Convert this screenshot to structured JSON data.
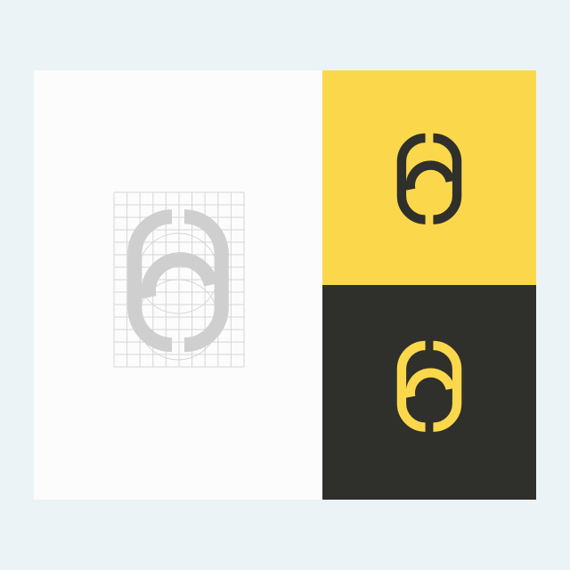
{
  "colors": {
    "page_background": "#ebf3f6",
    "construction_background": "#fcfcfc",
    "construction_mark": "#cfcfcf",
    "grid_line": "#d6d6d6",
    "brand_yellow": "#fbd84b",
    "brand_dark": "#2f2f2c"
  },
  "panels": {
    "construction": {
      "content": "logo-construction-grid"
    },
    "light": {
      "content": "logo-mark-dark-on-yellow"
    },
    "dark": {
      "content": "logo-mark-yellow-on-dark"
    }
  }
}
